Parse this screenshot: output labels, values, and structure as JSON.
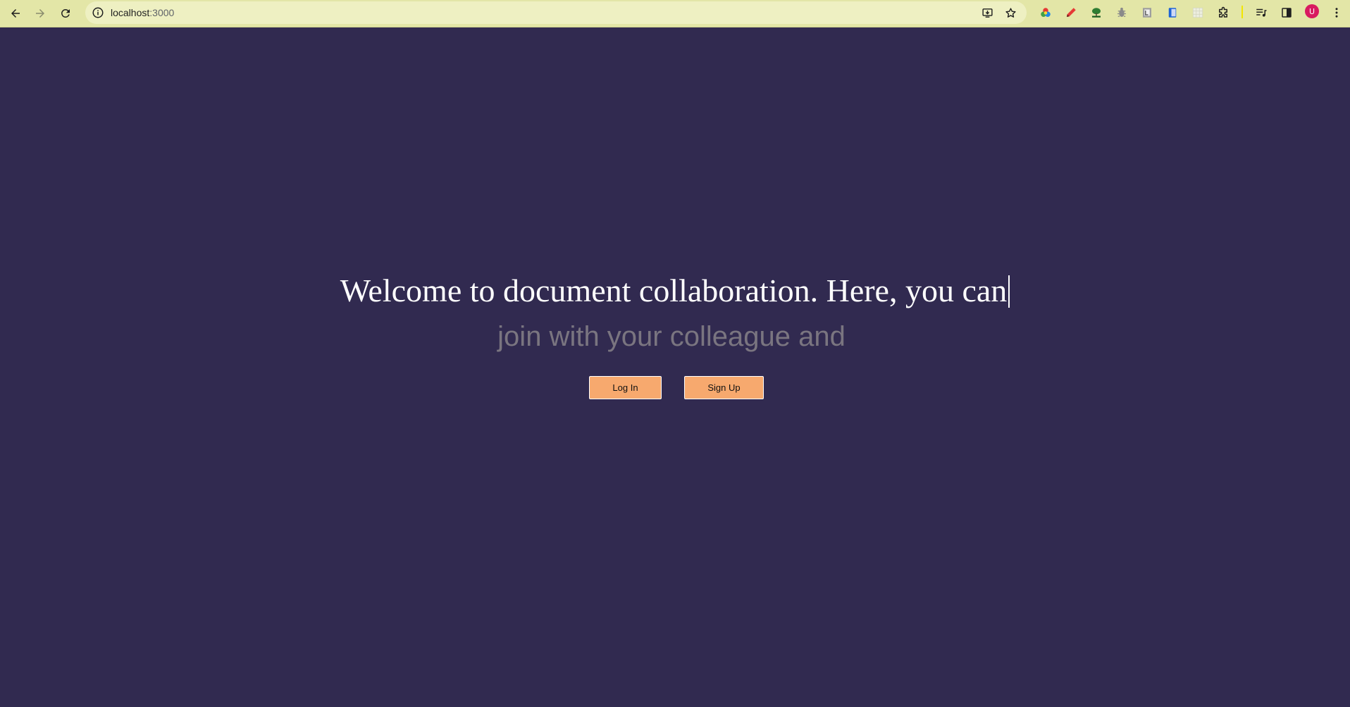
{
  "browser": {
    "url_host": "localhost",
    "url_port": ":3000",
    "avatar_initial": "U",
    "colors": {
      "toolbar_bg": "#e3e6a7",
      "omnibox_bg": "#eef0c2",
      "avatar": "#d81b60"
    }
  },
  "page": {
    "headline": "Welcome to document collaboration. Here, you can",
    "subline": "join with your colleague and",
    "buttons": {
      "login_label": "Log In",
      "signup_label": "Sign Up"
    },
    "colors": {
      "background": "#312a50",
      "headline": "#ffffff",
      "subline": "#7a7580",
      "button_bg": "#f7a96e"
    }
  }
}
